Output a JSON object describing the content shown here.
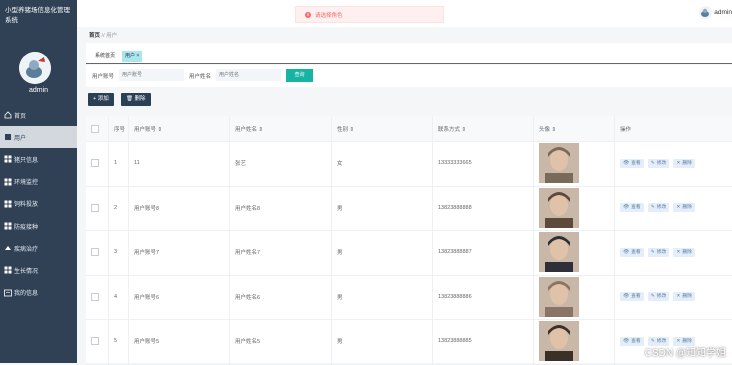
{
  "app": {
    "title": "小型养猪场信息化管理系统",
    "user": "admin",
    "top_user": "admin"
  },
  "menu": [
    {
      "label": "首页",
      "icon": "home-icon"
    },
    {
      "label": "用户",
      "icon": "user-icon",
      "active": true
    },
    {
      "label": "猪只信息",
      "icon": "grid-icon"
    },
    {
      "label": "环境监控",
      "icon": "grid-icon"
    },
    {
      "label": "饲料投放",
      "icon": "grid-icon"
    },
    {
      "label": "防疫接种",
      "icon": "grid-icon"
    },
    {
      "label": "疾病治疗",
      "icon": "grid-icon"
    },
    {
      "label": "生长情况",
      "icon": "grid-icon"
    },
    {
      "label": "我的信息",
      "icon": "profile-icon"
    }
  ],
  "toast": {
    "text": "请选择角色"
  },
  "breadcrumb": {
    "home": "首页",
    "sep": "//",
    "current": "用户"
  },
  "tabs": [
    {
      "label": "系统首页"
    },
    {
      "label": "用户 ×",
      "active": true
    }
  ],
  "search": {
    "account_label": "用户账号",
    "account_placeholder": "用户账号",
    "name_label": "用户姓名",
    "name_placeholder": "用户姓名",
    "button": "查询"
  },
  "actions": {
    "add": "+ 添加",
    "delete": "删除"
  },
  "table": {
    "headers": [
      "",
      "序号",
      "用户账号 ⇕",
      "用户姓名 ⇕",
      "性别 ⇕",
      "联系方式 ⇕",
      "头像 ⇕",
      "操作"
    ],
    "rows": [
      {
        "no": "1",
        "account": "11",
        "name": "张艺",
        "gender": "女",
        "phone": "13333333665"
      },
      {
        "no": "2",
        "account": "用户账号8",
        "name": "用户姓名8",
        "gender": "男",
        "phone": "13823888888"
      },
      {
        "no": "3",
        "account": "用户账号7",
        "name": "用户姓名7",
        "gender": "男",
        "phone": "13823888887"
      },
      {
        "no": "4",
        "account": "用户账号6",
        "name": "用户姓名6",
        "gender": "男",
        "phone": "13823888886"
      },
      {
        "no": "5",
        "account": "用户账号5",
        "name": "用户姓名5",
        "gender": "男",
        "phone": "13823888885"
      }
    ],
    "ops": {
      "view": "查看",
      "edit": "修改",
      "delete": "删除"
    }
  },
  "watermark": "CSDN @知知学姐",
  "colors": {
    "sidebar": "#304156",
    "accent": "#17b3a3",
    "error": "#f56c6c"
  }
}
